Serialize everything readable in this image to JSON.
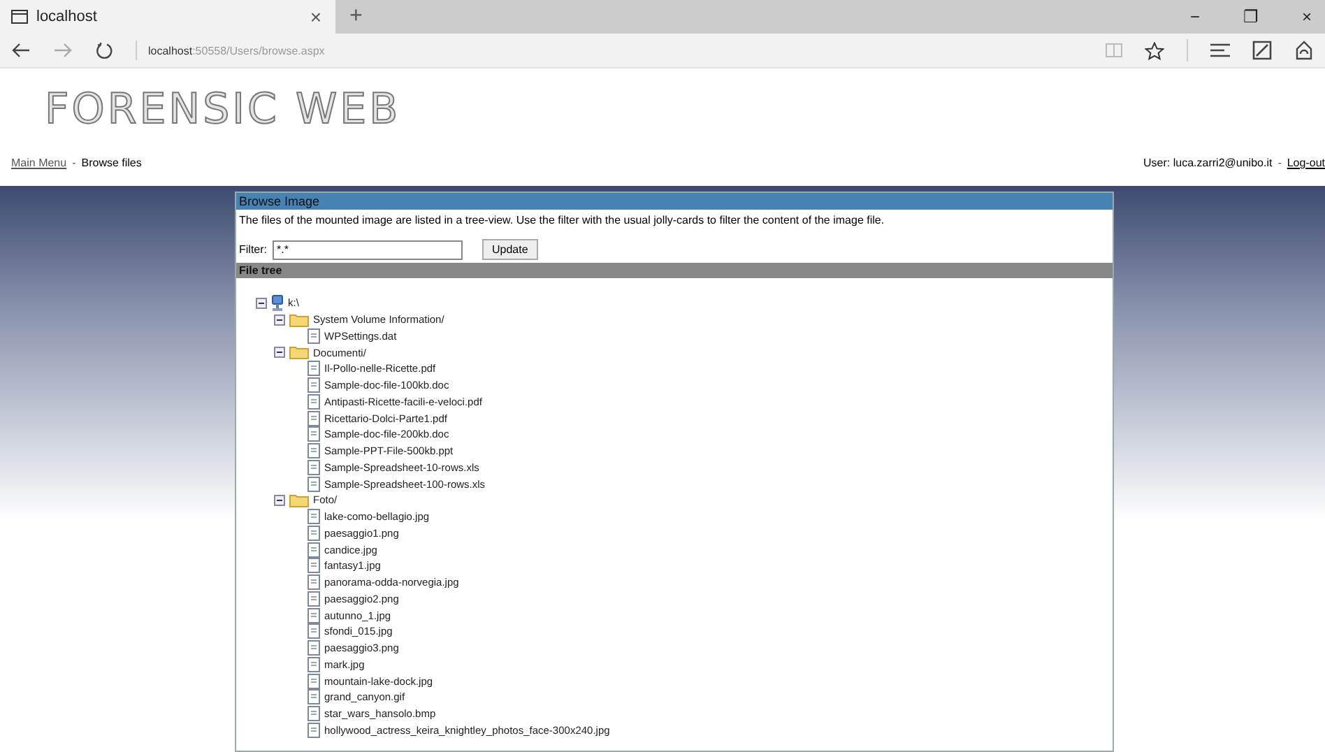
{
  "browser": {
    "tab": {
      "title": "localhost",
      "close": "×"
    },
    "new_tab": "+",
    "window_controls": [
      "−",
      "❐",
      "×"
    ],
    "address": {
      "host": "localhost",
      "path": ":50558/Users/browse.aspx"
    }
  },
  "logo": "FORENSIC WEB",
  "breadcrumb": {
    "link": "Main Menu",
    "separator": "-",
    "current": "Browse files"
  },
  "user": {
    "label": "User: luca.zarri2@unibo.it",
    "separator": "-",
    "logout": "Log-out"
  },
  "panel": {
    "title": "Browse Image",
    "description": "The files of the mounted image are listed in a tree-view. Use the filter with the usual jolly-cards to filter the content of the image file.",
    "filter": {
      "label": "Filter:",
      "value": "*.*",
      "button": "Update"
    },
    "tree_title": "File tree"
  },
  "tree": [
    {
      "kind": "drive",
      "label": "k:\\",
      "expanded": true,
      "children": [
        {
          "kind": "folder",
          "label": "System Volume Information/",
          "expanded": true,
          "children": [
            {
              "kind": "file",
              "label": "WPSettings.dat"
            }
          ]
        },
        {
          "kind": "folder",
          "label": "Documenti/",
          "expanded": true,
          "children": [
            {
              "kind": "file",
              "label": "Il-Pollo-nelle-Ricette.pdf"
            },
            {
              "kind": "file",
              "label": "Sample-doc-file-100kb.doc"
            },
            {
              "kind": "file",
              "label": "Antipasti-Ricette-facili-e-veloci.pdf"
            },
            {
              "kind": "file",
              "label": "Ricettario-Dolci-Parte1.pdf"
            },
            {
              "kind": "file",
              "label": "Sample-doc-file-200kb.doc"
            },
            {
              "kind": "file",
              "label": "Sample-PPT-File-500kb.ppt"
            },
            {
              "kind": "file",
              "label": "Sample-Spreadsheet-10-rows.xls"
            },
            {
              "kind": "file",
              "label": "Sample-Spreadsheet-100-rows.xls"
            }
          ]
        },
        {
          "kind": "folder",
          "label": "Foto/",
          "expanded": true,
          "children": [
            {
              "kind": "file",
              "label": "lake-como-bellagio.jpg"
            },
            {
              "kind": "file",
              "label": "paesaggio1.png"
            },
            {
              "kind": "file",
              "label": "candice.jpg"
            },
            {
              "kind": "file",
              "label": "fantasy1.jpg"
            },
            {
              "kind": "file",
              "label": "panorama-odda-norvegia.jpg"
            },
            {
              "kind": "file",
              "label": "paesaggio2.png"
            },
            {
              "kind": "file",
              "label": "autunno_1.jpg"
            },
            {
              "kind": "file",
              "label": "sfondi_015.jpg"
            },
            {
              "kind": "file",
              "label": "paesaggio3.png"
            },
            {
              "kind": "file",
              "label": "mark.jpg"
            },
            {
              "kind": "file",
              "label": "mountain-lake-dock.jpg"
            },
            {
              "kind": "file",
              "label": "grand_canyon.gif"
            },
            {
              "kind": "file",
              "label": "star_wars_hansolo.bmp"
            },
            {
              "kind": "file",
              "label": "hollywood_actress_keira_knightley_photos_face-300x240.jpg"
            }
          ]
        }
      ]
    }
  ]
}
